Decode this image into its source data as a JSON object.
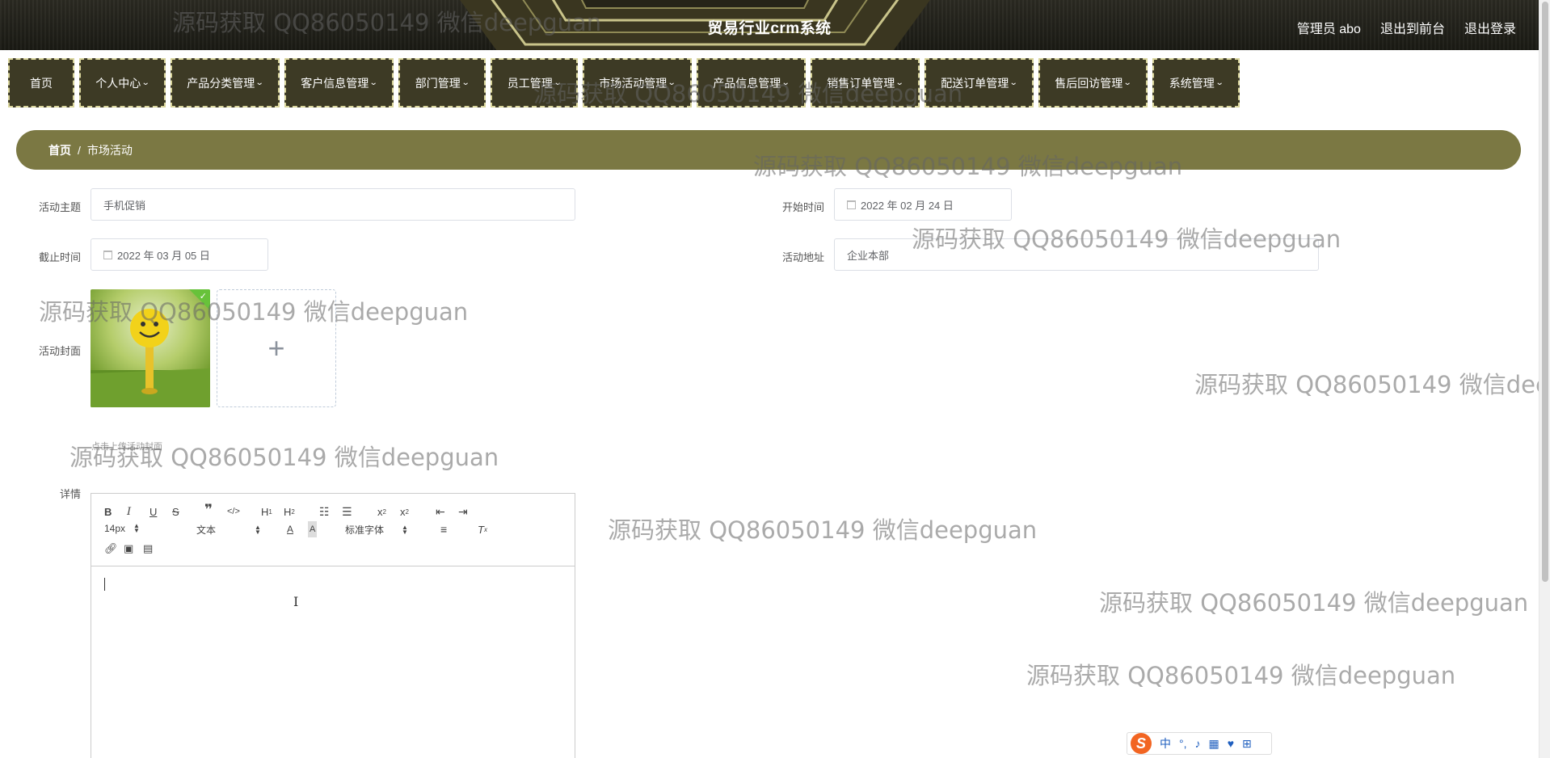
{
  "header": {
    "title": "贸易行业crm系统",
    "links": [
      "管理员 abo",
      "退出到前台",
      "退出登录"
    ]
  },
  "nav": {
    "items": [
      {
        "label": "首页",
        "has_dropdown": false
      },
      {
        "label": "个人中心",
        "has_dropdown": true
      },
      {
        "label": "产品分类管理",
        "has_dropdown": true
      },
      {
        "label": "客户信息管理",
        "has_dropdown": true
      },
      {
        "label": "部门管理",
        "has_dropdown": true
      },
      {
        "label": "员工管理",
        "has_dropdown": true
      },
      {
        "label": "市场活动管理",
        "has_dropdown": true
      },
      {
        "label": "产品信息管理",
        "has_dropdown": true
      },
      {
        "label": "销售订单管理",
        "has_dropdown": true
      },
      {
        "label": "配送订单管理",
        "has_dropdown": true
      },
      {
        "label": "售后回访管理",
        "has_dropdown": true
      },
      {
        "label": "系统管理",
        "has_dropdown": true
      }
    ]
  },
  "breadcrumb": {
    "home": "首页",
    "separator": "/",
    "current": "市场活动"
  },
  "form": {
    "theme_label": "活动主题",
    "theme_value": "手机促销",
    "start_label": "开始时间",
    "start_value": "2022 年 02 月 24 日",
    "end_label": "截止时间",
    "end_value": "2022 年 03 月 05 日",
    "address_label": "活动地址",
    "address_value": "企业本部",
    "cover_label": "活动封面",
    "cover_hint": "点击上传活动封面",
    "detail_label": "详情"
  },
  "editor": {
    "font_size": "14px",
    "paragraph": "文本",
    "font_family": "标准字体"
  },
  "watermark_text": "源码获取 QQ86050149 微信deepguan",
  "ime": {
    "lang": "中"
  },
  "colors": {
    "header_bg": "#1f1e18",
    "nav_bg": "#3d3a25",
    "nav_border": "#d8d49b",
    "breadcrumb_bg": "#7b7843",
    "success": "#67c23a"
  }
}
